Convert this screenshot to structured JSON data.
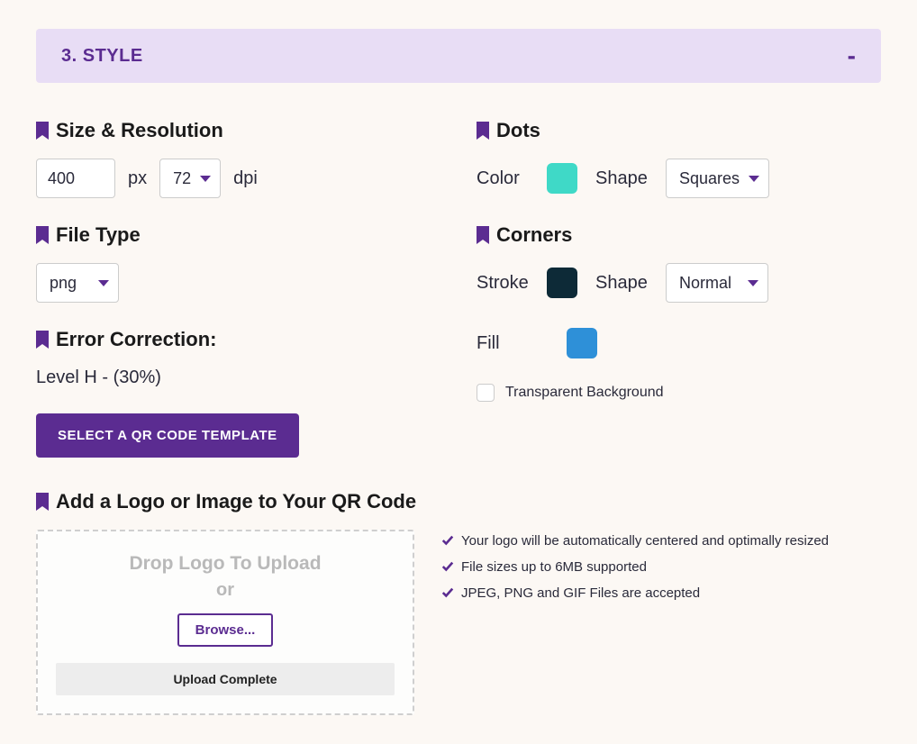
{
  "accordion": {
    "title": "3. STYLE",
    "toggle": "-"
  },
  "size": {
    "heading": "Size & Resolution",
    "value": "400",
    "unit_px": "px",
    "dpi": "72",
    "unit_dpi": "dpi"
  },
  "fileType": {
    "heading": "File Type",
    "value": "png"
  },
  "errorCorrection": {
    "heading": "Error Correction:",
    "value": "Level H - (30%)"
  },
  "templateBtn": "SELECT A QR CODE TEMPLATE",
  "dots": {
    "heading": "Dots",
    "color_label": "Color",
    "color": "#3fd9c7",
    "shape_label": "Shape",
    "shape": "Squares"
  },
  "corners": {
    "heading": "Corners",
    "stroke_label": "Stroke",
    "stroke_color": "#0d2a37",
    "shape_label": "Shape",
    "shape": "Normal",
    "fill_label": "Fill",
    "fill_color": "#2e90d8"
  },
  "transparent": {
    "label": "Transparent Background",
    "checked": false
  },
  "logo": {
    "heading": "Add a Logo or Image to Your QR Code",
    "drop_text": "Drop Logo To Upload",
    "or_text": "or",
    "browse": "Browse...",
    "progress": "Upload Complete",
    "tips": [
      "Your logo will be automatically centered and optimally resized",
      "File sizes up to 6MB supported",
      "JPEG, PNG and GIF Files are accepted"
    ]
  }
}
